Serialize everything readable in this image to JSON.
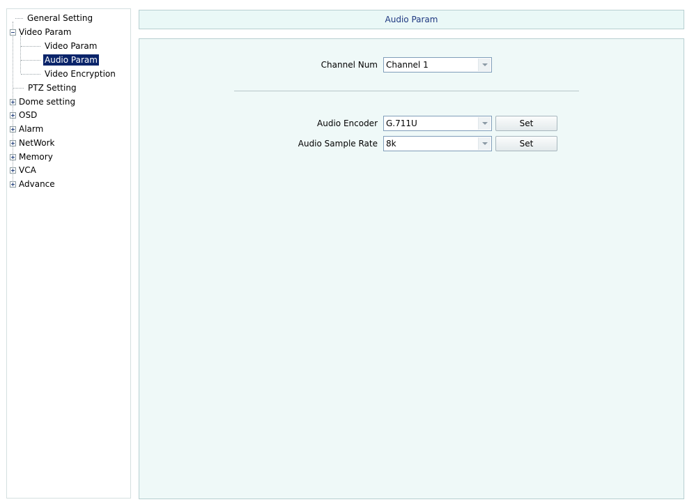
{
  "tree": {
    "items": [
      {
        "label": "General Setting"
      },
      {
        "label": "Video Param",
        "expander": "minus"
      },
      {
        "label": "Video Param"
      },
      {
        "label": "Audio Param",
        "selected": true
      },
      {
        "label": "Video Encryption"
      },
      {
        "label": "PTZ Setting"
      },
      {
        "label": "Dome setting",
        "expander": "plus"
      },
      {
        "label": "OSD",
        "expander": "plus"
      },
      {
        "label": "Alarm",
        "expander": "plus"
      },
      {
        "label": "NetWork",
        "expander": "plus"
      },
      {
        "label": "Memory",
        "expander": "plus"
      },
      {
        "label": "VCA",
        "expander": "plus"
      },
      {
        "label": "Advance",
        "expander": "plus"
      }
    ]
  },
  "header": {
    "title": "Audio Param"
  },
  "form": {
    "channel_num": {
      "label": "Channel Num",
      "value": "Channel  1"
    },
    "audio_encoder": {
      "label": "Audio Encoder",
      "value": "G.711U",
      "button": "Set"
    },
    "audio_sample_rate": {
      "label": "Audio Sample Rate",
      "value": "8k",
      "button": "Set"
    }
  },
  "colors": {
    "header_text": "#1d3780",
    "selected_bg": "#0a246a",
    "panel_bg": "#eff9f8"
  }
}
